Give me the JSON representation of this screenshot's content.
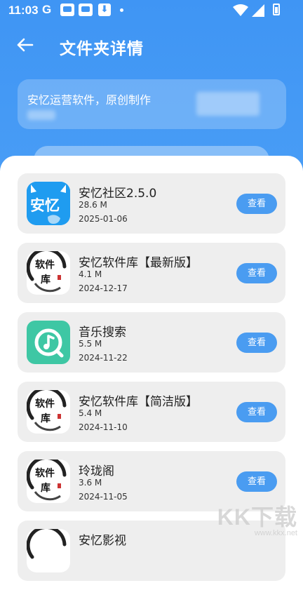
{
  "status_bar": {
    "time": "11:03",
    "g_label": "G",
    "download_glyph": "⬇",
    "icons": [
      "google-icon",
      "app-notification-icon",
      "app-notification-icon",
      "download-icon",
      "wifi-icon",
      "signal-icon",
      "battery-icon"
    ]
  },
  "nav": {
    "title": "文件夹详情",
    "back_icon": "arrow-left-icon"
  },
  "description": {
    "text": "安忆运营软件，原创制作"
  },
  "items": [
    {
      "name": "安忆社区2.5.0",
      "size": "28.6 M",
      "date": "2025-01-06",
      "icon": "anyi-icon",
      "button": "查看",
      "icon_text": "安忆"
    },
    {
      "name": "安忆软件库【最新版】",
      "size": "4.1 M",
      "date": "2024-12-17",
      "icon": "software-lib-icon",
      "button": "查看"
    },
    {
      "name": "音乐搜索",
      "size": "5.5 M",
      "date": "2024-11-22",
      "icon": "music-search-icon",
      "button": "查看"
    },
    {
      "name": "安忆软件库【简洁版】",
      "size": "5.4 M",
      "date": "2024-11-10",
      "icon": "software-lib-icon",
      "button": "查看"
    },
    {
      "name": "玲珑阁",
      "size": "3.6 M",
      "date": "2024-11-05",
      "icon": "software-lib-icon",
      "button": "查看"
    },
    {
      "name": "安忆影视",
      "size": "",
      "date": "",
      "icon": "software-lib-icon",
      "button": ""
    }
  ],
  "calligraphy_icon_text": {
    "top": "软件",
    "bottom": "库"
  },
  "watermark": {
    "main": "KK下载",
    "url": "www.kkx.net"
  },
  "colors": {
    "primary": "#3f95f4",
    "button": "#4a9cf1",
    "card": "#eeeeee",
    "music_icon": "#3ec7a4"
  }
}
